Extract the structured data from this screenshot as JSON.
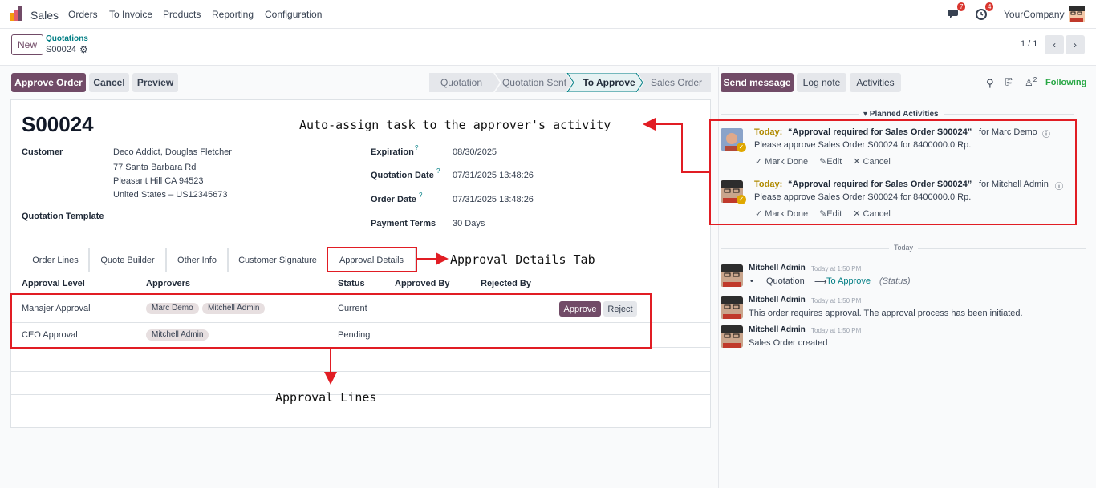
{
  "topbar": {
    "app": "Sales",
    "menu": [
      "Orders",
      "To Invoice",
      "Products",
      "Reporting",
      "Configuration"
    ],
    "messages_badge": "7",
    "activities_badge": "4",
    "company": "YourCompany"
  },
  "control": {
    "new_label": "New",
    "breadcrumb_parent": "Quotations",
    "breadcrumb_current": "S00024",
    "pager": "1 / 1"
  },
  "actions": {
    "approve_order": "Approve Order",
    "cancel": "Cancel",
    "preview": "Preview"
  },
  "stages": [
    "Quotation",
    "Quotation Sent",
    "To Approve",
    "Sales Order"
  ],
  "active_stage": "To Approve",
  "record": {
    "name": "S00024",
    "customer_label": "Customer",
    "customer_lines": [
      "Deco Addict, Douglas Fletcher",
      "77 Santa Barbara Rd",
      "Pleasant Hill CA 94523",
      "United States – US12345673"
    ],
    "quotation_template_label": "Quotation Template",
    "expiration_label": "Expiration",
    "expiration": "08/30/2025",
    "quotation_date_label": "Quotation Date",
    "quotation_date": "07/31/2025 13:48:26",
    "order_date_label": "Order Date",
    "order_date": "07/31/2025 13:48:26",
    "payment_terms_label": "Payment Terms",
    "payment_terms": "30 Days",
    "help_mark": "?"
  },
  "tabs": [
    "Order Lines",
    "Quote Builder",
    "Other Info",
    "Customer Signature",
    "Approval Details"
  ],
  "approval_table": {
    "headers": [
      "Approval Level",
      "Approvers",
      "Status",
      "Approved By",
      "Rejected By"
    ],
    "rows": [
      {
        "level": "Manajer Approval",
        "approvers": [
          "Marc Demo",
          "Mitchell Admin"
        ],
        "status": "Current",
        "approve": "Approve",
        "reject": "Reject"
      },
      {
        "level": "CEO Approval",
        "approvers": [
          "Mitchell Admin"
        ],
        "status": "Pending"
      }
    ]
  },
  "annotations": {
    "activity": "Auto-assign task to the approver's activity",
    "tab": "Approval Details Tab",
    "lines": "Approval Lines"
  },
  "chatter": {
    "send_message": "Send message",
    "log_note": "Log note",
    "activities": "Activities",
    "followers_count": "2",
    "following": "Following",
    "planned_header": "▾ Planned Activities",
    "activities_list": [
      {
        "today": "Today:",
        "title": "“Approval required for Sales Order S00024”",
        "for": "for Marc Demo",
        "body": "Please approve Sales Order S00024 for 8400000.0 Rp."
      },
      {
        "today": "Today:",
        "title": "“Approval required for Sales Order S00024”",
        "for": "for Mitchell Admin",
        "body": "Please approve Sales Order S00024 for 8400000.0 Rp."
      }
    ],
    "mark_done": "Mark Done",
    "edit": "Edit",
    "cancel": "Cancel",
    "today_divider": "Today",
    "messages": [
      {
        "author": "Mitchell Admin",
        "time": "Today at 1:50 PM",
        "from": "Quotation",
        "to": "To Approve",
        "field": "(Status)"
      },
      {
        "author": "Mitchell Admin",
        "time": "Today at 1:50 PM",
        "body": "This order requires approval. The approval process has been initiated."
      },
      {
        "author": "Mitchell Admin",
        "time": "Today at 1:50 PM",
        "body": "Sales Order created"
      }
    ]
  },
  "colors": {
    "brand": "#714b67",
    "accent": "#017e84",
    "annotation": "#e11d24",
    "today": "#b08a00"
  }
}
